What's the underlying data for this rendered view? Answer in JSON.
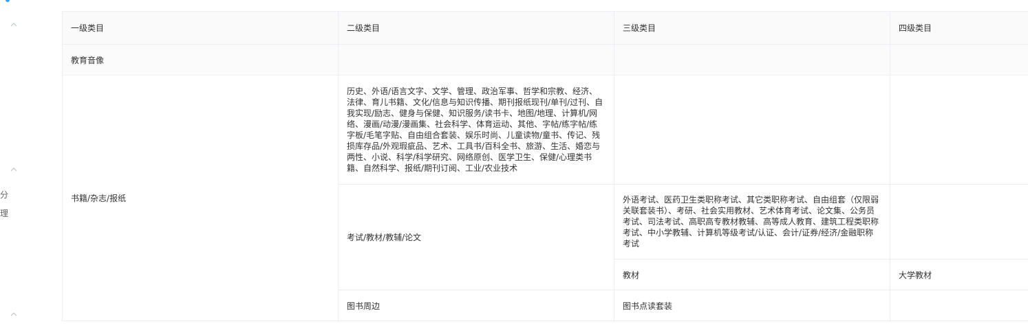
{
  "sidebar": {
    "chevrons": [
      "up",
      "up",
      "up"
    ],
    "fragments": [
      "分",
      "理"
    ]
  },
  "table": {
    "headers": [
      "一级类目",
      "二级类目",
      "三级类目",
      "四级类目"
    ],
    "rows": {
      "education": {
        "level1": "教育音像",
        "level2": "",
        "level3": "",
        "level4": ""
      },
      "books": {
        "level1": "书籍/杂志/报纸",
        "sub1": {
          "level2": "历史、外语/语言文字、文学、管理、政治军事、哲学和宗教、经济、法律、育儿书籍、文化/信息与知识传播、期刊报纸现刊/单刊/过刊、自我实现/励志、健身与保健、知识服务/读书卡、地图/地理、计算机/网络、漫画/动漫/漫画集、社会科学、体育运动、其他、字帖/练字帖/练字板/毛笔字贴、自由组合套装、娱乐时尚、儿童读物/童书、传记、残损库存品/外观瑕疵品、艺术、工具书/百科全书、旅游、生活、婚恋与两性、小说、科学/科学研究、网络原创、医学卫生、保健/心理类书籍、自然科学、报纸/期刊订阅、工业/农业技术",
          "level3": "",
          "level4": ""
        },
        "sub2": {
          "level2": "考试/教材/教辅/论文",
          "exam": {
            "level3": "外语考试、医药卫生类职称考试、其它类职称考试、自由组套（仅限弱关联套装书）、考研、社会实用教材、艺术体育考试、论文集、公务员考试、司法考试、高职高专教材教辅、高等成人教育、建筑工程类职称考试、中小学教辅、计算机等级考试/认证、会计/证券/经济/金融职称考试",
            "level4": ""
          },
          "textbook": {
            "level3": "教材",
            "level4": "大学教材"
          }
        },
        "sub3": {
          "level2": "图书周边",
          "level3": "图书点读套装",
          "level4": ""
        }
      }
    }
  }
}
